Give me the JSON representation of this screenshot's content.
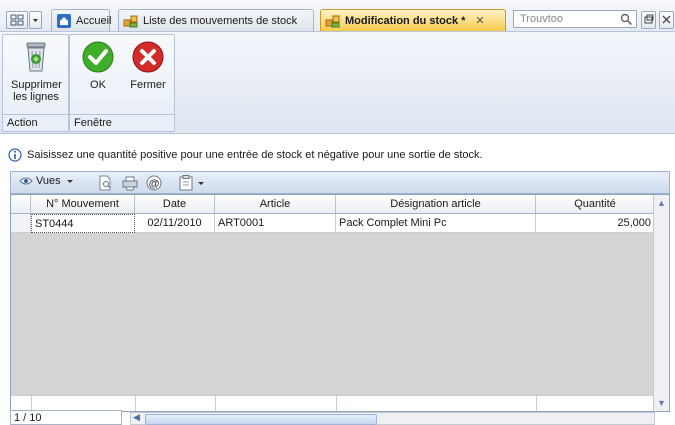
{
  "tabs": [
    {
      "label": "Accueil",
      "icon": "home-icon"
    },
    {
      "label": "Liste des mouvements de stock",
      "icon": "stock-icon"
    },
    {
      "label": "Modification du stock *",
      "icon": "stock-icon",
      "active": true
    }
  ],
  "search": {
    "placeholder": "Trouvtoo"
  },
  "ribbon": {
    "groups": [
      {
        "label": "Action",
        "buttons": [
          {
            "label": "Supprimer les lignes",
            "icon": "trash-icon"
          }
        ]
      },
      {
        "label": "Fenêtre",
        "buttons": [
          {
            "label": "OK",
            "icon": "ok-check-icon"
          },
          {
            "label": "Fermer",
            "icon": "close-cross-icon"
          }
        ]
      }
    ]
  },
  "info_message": "Saisissez une quantité positive pour une entrée de stock et négative pour une sortie de stock.",
  "grid_toolbar": {
    "views_label": "Vues"
  },
  "grid": {
    "columns": [
      "N° Mouvement",
      "Date",
      "Article",
      "Désignation article",
      "Quantité"
    ],
    "rows": [
      [
        "ST0444",
        "02/11/2010",
        "ART0001",
        "Pack Complet Mini Pc",
        "25,000"
      ]
    ]
  },
  "pager": {
    "text": "1 / 10"
  },
  "colors": {
    "active_tab": "#f6c94a",
    "ok_green": "#3fae2a",
    "close_red": "#d42a2a",
    "empty_grid": "#d4d4d4"
  }
}
